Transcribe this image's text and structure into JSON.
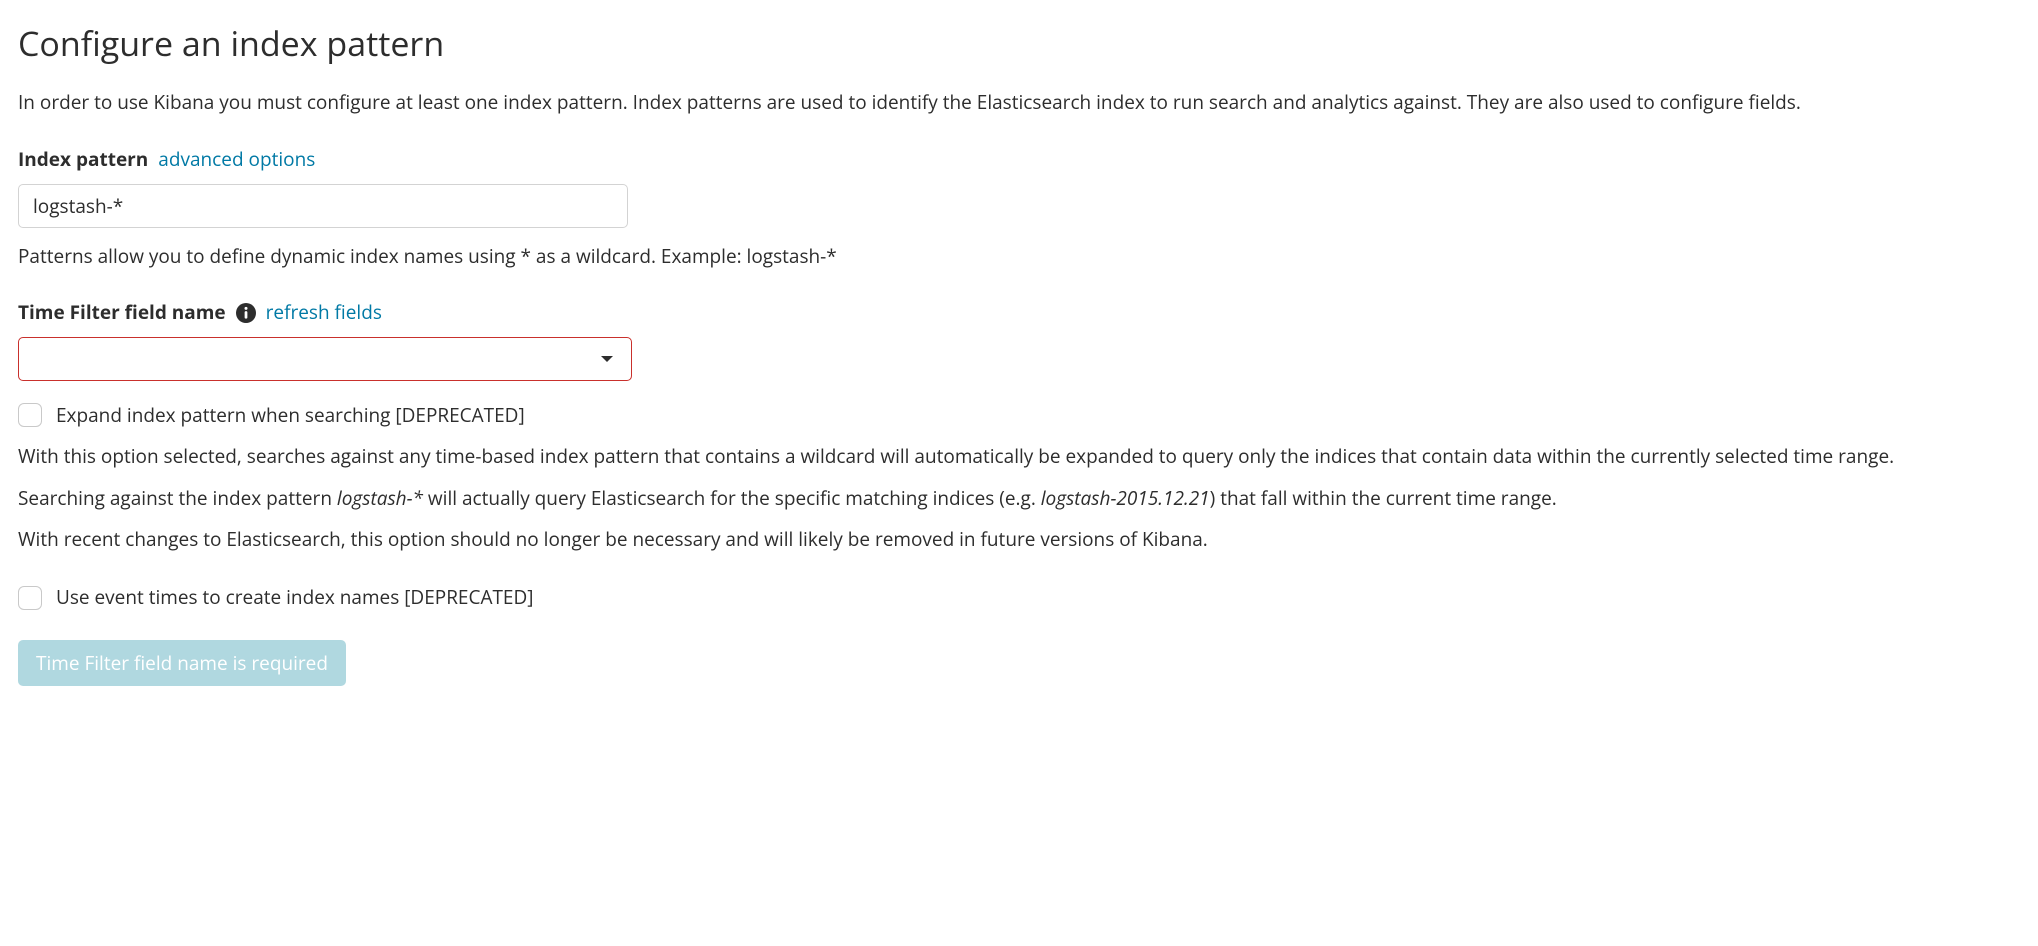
{
  "page": {
    "title": "Configure an index pattern",
    "intro": "In order to use Kibana you must configure at least one index pattern. Index patterns are used to identify the Elasticsearch index to run search and analytics against. They are also used to configure fields."
  },
  "index_pattern": {
    "label": "Index pattern",
    "advanced_link": "advanced options",
    "value": "logstash-*",
    "help": "Patterns allow you to define dynamic index names using * as a wildcard. Example: logstash-*"
  },
  "time_filter": {
    "label": "Time Filter field name",
    "refresh_link": "refresh fields",
    "value": ""
  },
  "expand_option": {
    "label": "Expand index pattern when searching [DEPRECATED]",
    "desc1": "With this option selected, searches against any time-based index pattern that contains a wildcard will automatically be expanded to query only the indices that contain data within the currently selected time range.",
    "desc2_pre": "Searching against the index pattern ",
    "desc2_pattern": "logstash-*",
    "desc2_mid": " will actually query Elasticsearch for the specific matching indices (e.g. ",
    "desc2_example": "logstash-2015.12.21",
    "desc2_post": ") that fall within the current time range.",
    "desc3": "With recent changes to Elasticsearch, this option should no longer be necessary and will likely be removed in future versions of Kibana."
  },
  "event_times_option": {
    "label": "Use event times to create index names [DEPRECATED]"
  },
  "submit": {
    "label": "Time Filter field name is required"
  }
}
